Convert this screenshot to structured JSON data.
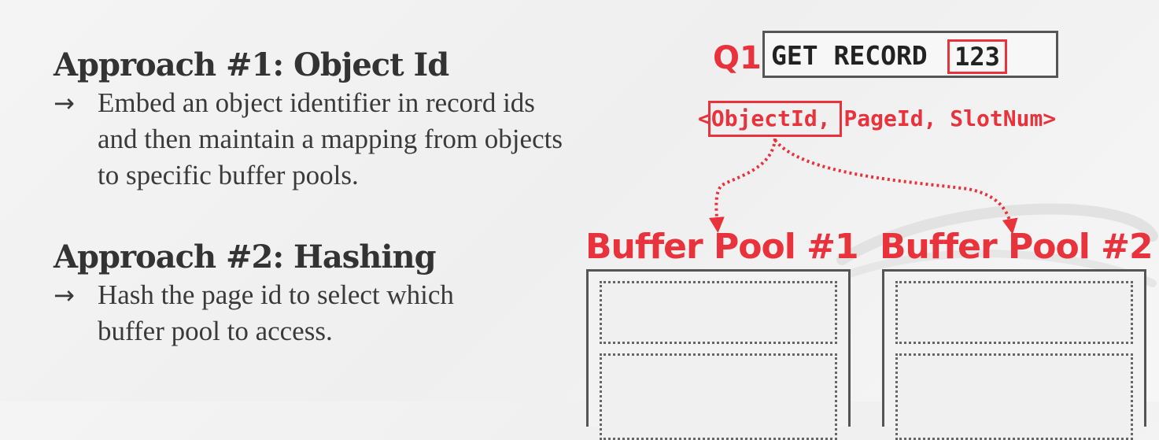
{
  "approach1": {
    "heading": "Approach #1: Object Id",
    "arrow": "→",
    "bullet_lines": [
      "Embed an object identifier in record ids",
      "and then maintain a mapping from objects",
      "to specific buffer pools."
    ]
  },
  "approach2": {
    "heading": "Approach #2: Hashing",
    "arrow": "→",
    "bullet_lines": [
      "Hash the page id to select which",
      "buffer pool to access."
    ]
  },
  "query": {
    "label": "Q1",
    "command": "GET RECORD",
    "record_id": "123"
  },
  "record_tuple": {
    "open": "<",
    "object_id": "ObjectId",
    "rest": ", PageId, SlotNum>"
  },
  "buffer_pools": [
    {
      "title": "Buffer Pool #1"
    },
    {
      "title": "Buffer Pool #2"
    }
  ],
  "colors": {
    "accent": "#e8323c",
    "text": "#333333",
    "border": "#555555"
  }
}
